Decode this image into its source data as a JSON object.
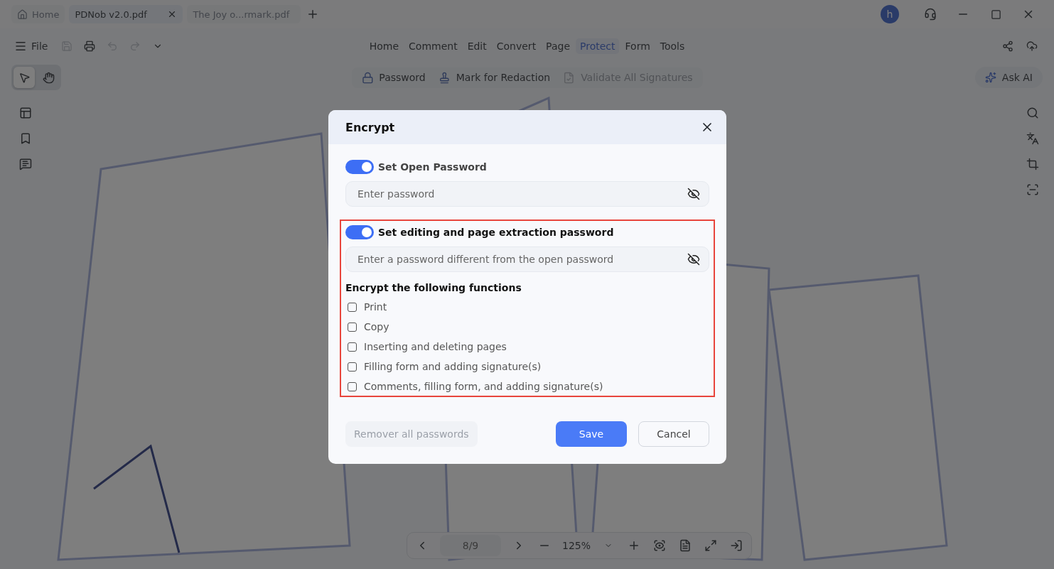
{
  "tabs": [
    {
      "kind": "home",
      "label": "Home",
      "selected": false
    },
    {
      "kind": "file",
      "label": "PDNob v2.0.pdf",
      "selected": true
    },
    {
      "kind": "file",
      "label": "The Joy o...rmark.pdf",
      "selected": false
    }
  ],
  "avatar": "h",
  "file_menu": "File",
  "menu": [
    {
      "label": "Home",
      "selected": false
    },
    {
      "label": "Comment",
      "selected": false
    },
    {
      "label": "Edit",
      "selected": false
    },
    {
      "label": "Convert",
      "selected": false
    },
    {
      "label": "Page",
      "selected": false
    },
    {
      "label": "Protect",
      "selected": true
    },
    {
      "label": "Form",
      "selected": false
    },
    {
      "label": "Tools",
      "selected": false
    }
  ],
  "tools": [
    {
      "kind": "pointer",
      "selected": true
    },
    {
      "kind": "hand",
      "selected": false
    }
  ],
  "ribbon": [
    {
      "kind": "lock",
      "label": "Password",
      "disabled": false
    },
    {
      "kind": "redact",
      "label": "Mark for Redaction",
      "disabled": false
    },
    {
      "kind": "signature",
      "label": "Validate All Signatures",
      "disabled": true
    }
  ],
  "ask_ai": "Ask AI",
  "page_nav": {
    "page": "8/9",
    "zoom": "125%"
  },
  "dialog": {
    "title": "Encrypt",
    "open_password": {
      "on": true,
      "label": "Set Open Password",
      "placeholder": "Enter password"
    },
    "edit_password": {
      "on": true,
      "highlighted": true,
      "label": "Set editing and page extraction password",
      "placeholder": "Enter a password different from the open password"
    },
    "functions_title": "Encrypt the following functions",
    "functions": [
      {
        "label": "Print",
        "checked": false
      },
      {
        "label": "Copy",
        "checked": false
      },
      {
        "label": "Inserting and deleting pages",
        "checked": false
      },
      {
        "label": "Filling form and adding signature(s)",
        "checked": false
      },
      {
        "label": "Comments, filling form, and adding signature(s)",
        "checked": false
      }
    ],
    "remove_button": {
      "label": "Remover all passwords",
      "disabled": true
    },
    "save": "Save",
    "cancel": "Cancel"
  }
}
